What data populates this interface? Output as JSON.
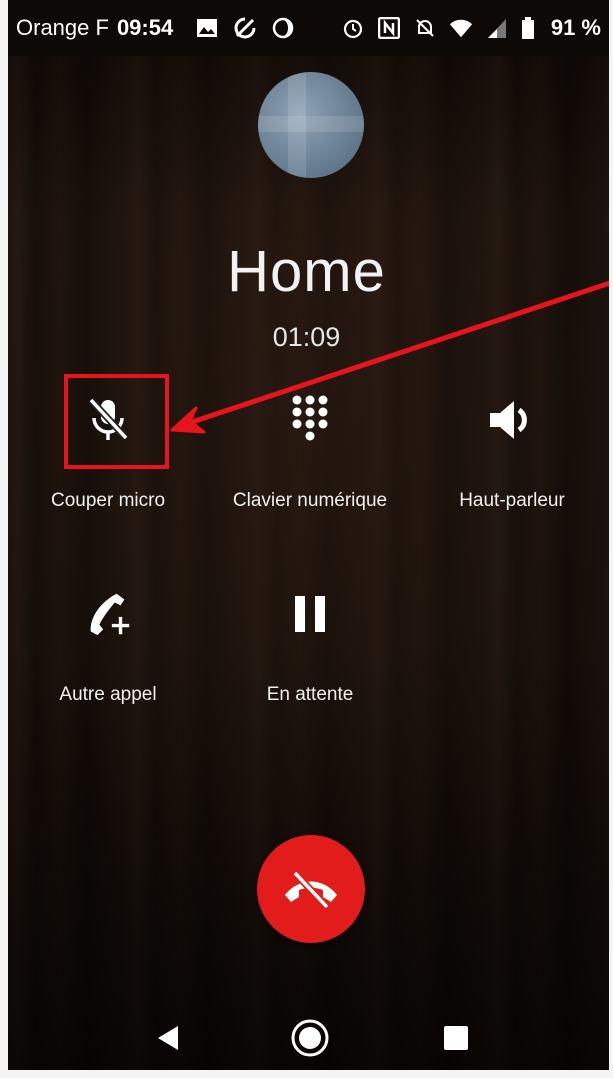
{
  "status_bar": {
    "carrier": "Orange F",
    "time": "09:54",
    "battery_percent": "91 %",
    "icons": [
      "image-icon",
      "sync-off-icon",
      "moon-icon",
      "alarm-icon",
      "nfc-icon",
      "bell-off-icon",
      "wifi-icon",
      "signal-icon",
      "battery-icon"
    ]
  },
  "call": {
    "contact_name": "Home",
    "duration": "01:09"
  },
  "controls": {
    "mute": {
      "label": "Couper micro",
      "icon": "mic-off-icon"
    },
    "keypad": {
      "label": "Clavier numérique",
      "icon": "dialpad-icon"
    },
    "speaker": {
      "label": "Haut-parleur",
      "icon": "speaker-icon"
    },
    "add_call": {
      "label": "Autre appel",
      "icon": "add-call-icon"
    },
    "hold": {
      "label": "En attente",
      "icon": "pause-icon"
    }
  },
  "end_call": {
    "icon": "hang-up-icon",
    "color": "#e21b1b"
  },
  "annotation": {
    "color": "#e8141c",
    "target": "mute"
  },
  "nav_bar": {
    "icons": [
      "back-icon",
      "home-icon",
      "recents-icon"
    ]
  }
}
